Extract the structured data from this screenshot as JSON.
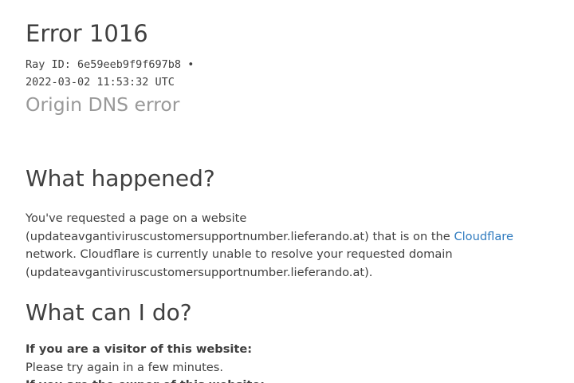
{
  "header": {
    "error_code": "Error 1016",
    "ray_id_line": "Ray ID: 6e59eeb9f9f697b8 •",
    "timestamp": "2022-03-02 11:53:32 UTC",
    "subtitle": "Origin DNS error"
  },
  "what_happened": {
    "heading": "What happened?",
    "text_before_link": "You've requested a page on a website (updateavgantiviruscustomersupportnumber.lieferando.at) that is on the ",
    "link_label": "Cloudflare",
    "text_after_link": " network. Cloudflare is currently unable to resolve your requested domain (updateavgantiviruscustomersupportnumber.lieferando.at)."
  },
  "what_can_i_do": {
    "heading": "What can I do?",
    "visitor_heading": "If you are a visitor of this website:",
    "visitor_text": "Please try again in a few minutes.",
    "owner_heading": "If you are the owner of this website:"
  },
  "colors": {
    "text": "#404040",
    "subtitle": "#999999",
    "link": "#2f7bbf"
  }
}
